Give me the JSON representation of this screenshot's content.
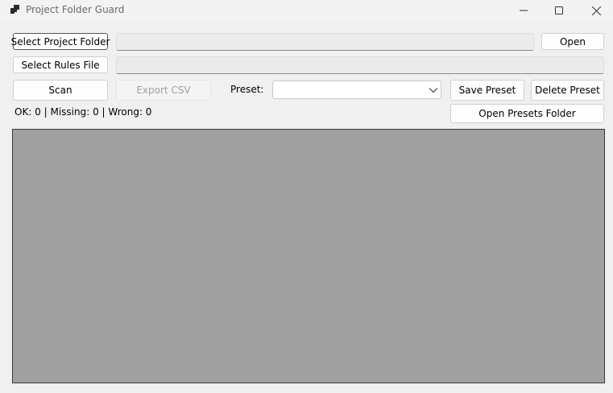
{
  "window": {
    "title": "Project Folder Guard"
  },
  "controls": {
    "select_project_folder": "Select Project Folder",
    "project_folder_path": "",
    "open": "Open",
    "select_rules_file": "Select Rules File",
    "rules_file_path": "",
    "scan": "Scan",
    "export_csv": "Export CSV",
    "preset_label": "Preset:",
    "preset_value": "",
    "save_preset": "Save Preset",
    "delete_preset": "Delete Preset",
    "open_presets_folder": "Open Presets Folder",
    "status": "OK: 0 | Missing: 0 | Wrong: 0"
  },
  "icons": {
    "app": "app-icon",
    "minimize": "minimize-icon",
    "maximize": "maximize-icon",
    "close": "close-icon",
    "combo_arrow": "chevron-down-icon"
  },
  "colors": {
    "focus_border": "#1f5fb8",
    "results_background": "#a0a0a0"
  }
}
